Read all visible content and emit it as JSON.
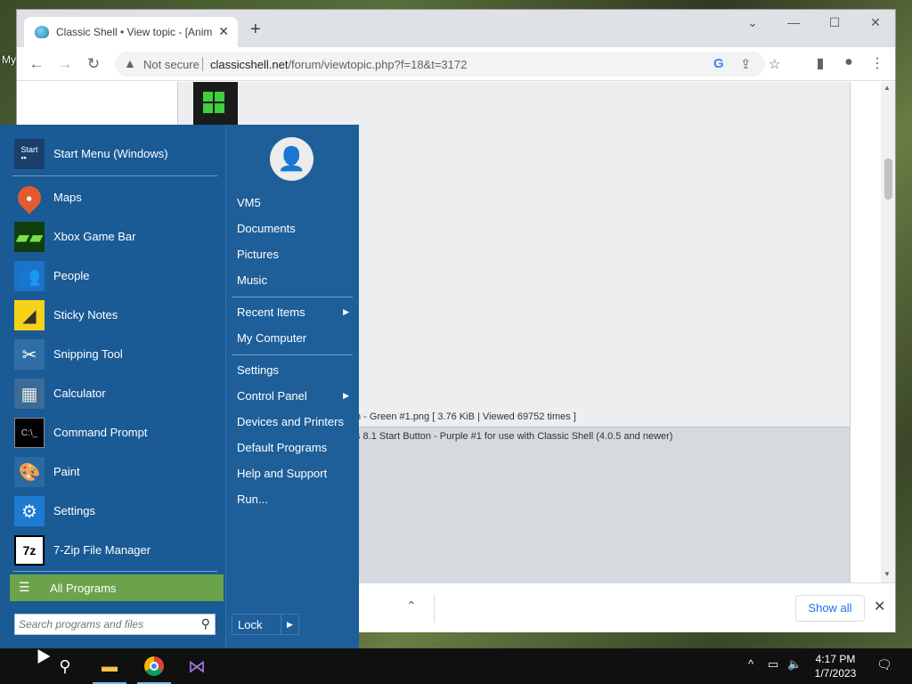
{
  "desktop": {
    "label": "My"
  },
  "browser": {
    "tab_title": "Classic Shell • View topic - [Anim",
    "tab_close": "✕",
    "new_tab": "+",
    "window_controls": {
      "minimize": "—",
      "maximize": "☐",
      "close": "✕",
      "tab_search": "⌄"
    },
    "nav": {
      "back": "←",
      "forward": "→",
      "reload": "↻"
    },
    "security_warning": "Not secure",
    "url_host": "classicshell.net",
    "url_path": "/forum/viewtopic.php?f=18&t=3172",
    "page": {
      "attachment_1": "n - Green #1.png [ 3.76 KiB | Viewed 69752 times ]",
      "attachment_2": "s 8.1 Start Button - Purple #1 for use with Classic Shell (4.0.5 and newer)"
    },
    "download_bar": {
      "show_all": "Show all",
      "close": "✕",
      "chevron": "⌃"
    }
  },
  "start_menu": {
    "pinned": [
      {
        "label": "Start Menu (Windows)",
        "icon": "start-menu-icon"
      }
    ],
    "programs": [
      {
        "label": "Maps",
        "icon": "maps-icon"
      },
      {
        "label": "Xbox Game Bar",
        "icon": "xbox-game-bar-icon"
      },
      {
        "label": "People",
        "icon": "people-icon"
      },
      {
        "label": "Sticky Notes",
        "icon": "sticky-notes-icon"
      },
      {
        "label": "Snipping Tool",
        "icon": "snipping-tool-icon"
      },
      {
        "label": "Calculator",
        "icon": "calculator-icon"
      },
      {
        "label": "Command Prompt",
        "icon": "command-prompt-icon"
      },
      {
        "label": "Paint",
        "icon": "paint-icon"
      },
      {
        "label": "Settings",
        "icon": "settings-gear-icon"
      },
      {
        "label": "7-Zip File Manager",
        "icon": "7zip-icon"
      }
    ],
    "all_programs": "All Programs",
    "search_placeholder": "Search programs and files",
    "right": {
      "group1": [
        "VM5",
        "Documents",
        "Pictures",
        "Music"
      ],
      "group2": [
        {
          "label": "Recent Items",
          "submenu": true
        },
        {
          "label": "My Computer",
          "submenu": false
        }
      ],
      "group3": [
        {
          "label": "Settings",
          "submenu": false
        },
        {
          "label": "Control Panel",
          "submenu": true
        },
        {
          "label": "Devices and Printers",
          "submenu": false
        },
        {
          "label": "Default Programs",
          "submenu": false
        },
        {
          "label": "Help and Support",
          "submenu": false
        },
        {
          "label": "Run...",
          "submenu": false
        }
      ]
    },
    "lock": "Lock"
  },
  "taskbar": {
    "time": "4:17 PM",
    "date": "1/7/2023",
    "colors": {
      "accent": "#76b9ed",
      "start_bg": "#1e5f9a",
      "all_programs": "#6aa34a"
    }
  }
}
